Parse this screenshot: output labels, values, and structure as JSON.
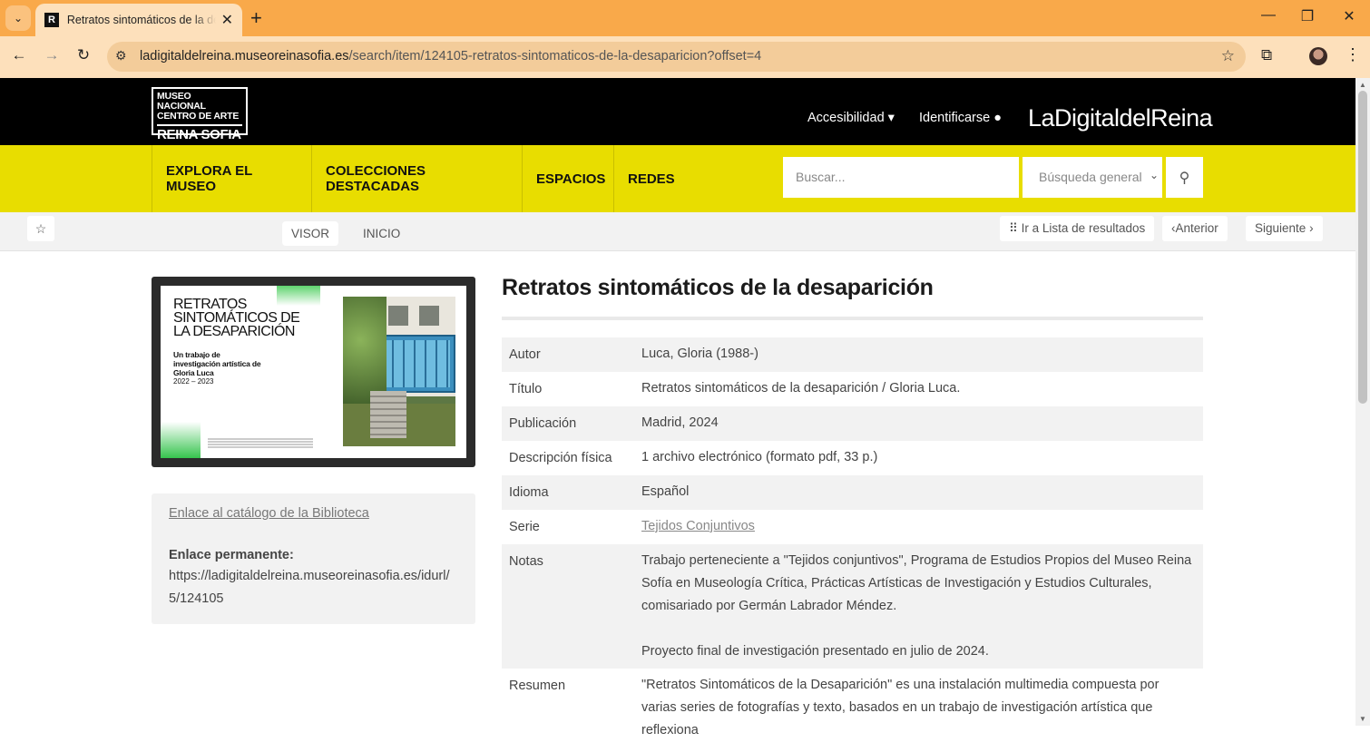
{
  "browser": {
    "tab_title": "Retratos sintomáticos de la desaparición",
    "tab_favicon_letter": "R",
    "url_host": "ladigitaldelreina.museoreinasofia.es",
    "url_path": "/search/item/124105-retratos-sintomaticos-de-la-desaparicion?offset=4"
  },
  "header": {
    "logo_line1": "MUSEO NACIONAL",
    "logo_line2": "CENTRO DE ARTE",
    "logo_line3": "REINA SOFIA",
    "accessibility": "Accesibilidad ▾",
    "login": "Identificarse",
    "brand": "LaDigitaldelReina"
  },
  "menu": {
    "items": [
      "EXPLORA EL MUSEO",
      "COLECCIONES DESTACADAS",
      "ESPACIOS",
      "REDES"
    ]
  },
  "search": {
    "placeholder": "Buscar...",
    "scope_selected": "Búsqueda general"
  },
  "subbar": {
    "tab_viewer": "VISOR",
    "tab_home": "INICIO",
    "results_list": "Ir a Lista de resultados",
    "previous": "Anterior",
    "next": "Siguiente"
  },
  "cover": {
    "title": "RETRATOS SINTOMÁTICOS DE LA DESAPARICIÓN",
    "subtitle": "Un trabajo de investigación artística de Gloria Luca",
    "years": "2022 – 2023"
  },
  "sidebar": {
    "catalog_link": "Enlace al catálogo de la Biblioteca",
    "permalink_label": "Enlace permanente:",
    "permalink_url": "https://ladigitaldelreina.museoreinasofia.es/idurl/5/124105"
  },
  "record": {
    "title": "Retratos sintomáticos de la desaparición",
    "fields": [
      {
        "label": "Autor",
        "value": "Luca, Gloria (1988-)"
      },
      {
        "label": "Título",
        "value": "Retratos sintomáticos de la desaparición / Gloria Luca."
      },
      {
        "label": "Publicación",
        "value": "Madrid, 2024"
      },
      {
        "label": "Descripción física",
        "value": "1 archivo electrónico (formato pdf, 33 p.)"
      },
      {
        "label": "Idioma",
        "value": "Español"
      },
      {
        "label": "Serie",
        "value": "Tejidos Conjuntivos"
      },
      {
        "label": "Notas",
        "value": "Trabajo perteneciente a \"Tejidos conjuntivos\", Programa de Estudios Propios del Museo Reina Sofía en Museología Crítica, Prácticas Artísticas de Investigación y Estudios Culturales, comisariado por Germán Labrador Méndez.",
        "value2": "Proyecto final de investigación presentado en julio de 2024."
      },
      {
        "label": "Resumen",
        "value": "\"Retratos Sintomáticos de la Desaparición\" es una instalación multimedia compuesta por varias series de fotografías y texto, basados en un trabajo de investigación artística que reflexiona"
      }
    ]
  }
}
